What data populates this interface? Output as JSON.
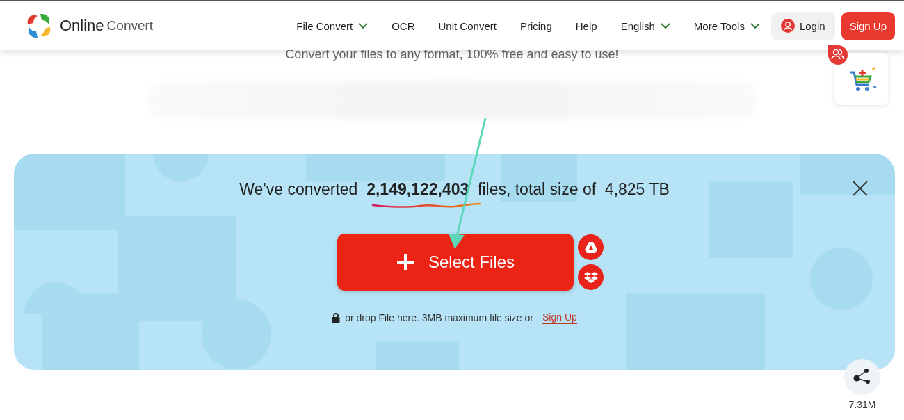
{
  "header": {
    "logo": {
      "word_1": "Online",
      "word_2": "Convert"
    },
    "nav": [
      {
        "label": "File Convert",
        "dropdown": true
      },
      {
        "label": "OCR",
        "dropdown": false
      },
      {
        "label": "Unit Convert",
        "dropdown": false
      },
      {
        "label": "Pricing",
        "dropdown": false
      },
      {
        "label": "Help",
        "dropdown": false
      },
      {
        "label": "English",
        "dropdown": true
      },
      {
        "label": "More Tools",
        "dropdown": true
      }
    ],
    "login": "Login",
    "signup": "Sign Up"
  },
  "tagline": "Convert your files to any format, 100% free and easy to use!",
  "converter": {
    "stats": "We've converted  **2,149,122,403**  files, total size of  4,825 TB",
    "select_button": "Select Files",
    "hint": "or drop File here. 3MB maximum file size or",
    "hint_link": "Sign Up"
  },
  "share": {
    "count": "7.31M"
  }
}
